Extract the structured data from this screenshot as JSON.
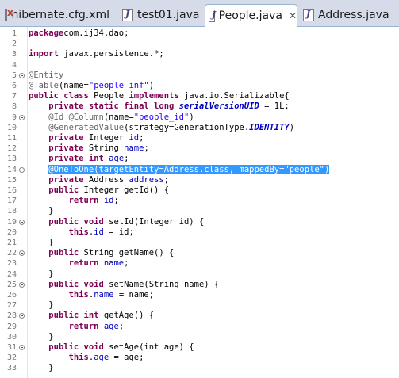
{
  "tabs": [
    {
      "label": "hibernate.cfg.xml",
      "icon": "xml-file-icon"
    },
    {
      "label": "test01.java",
      "icon": "java-file-icon"
    },
    {
      "label": "People.java",
      "icon": "java-file-icon",
      "active": true,
      "close": "✕"
    },
    {
      "label": "Address.java",
      "icon": "java-file-icon"
    }
  ],
  "editor": {
    "lines": [
      {
        "n": "1",
        "segs": [
          [
            "kw",
            "package"
          ],
          [
            "",
            "com.ij34.dao;"
          ]
        ]
      },
      {
        "n": "2",
        "segs": []
      },
      {
        "n": "3",
        "segs": [
          [
            "kw",
            "import"
          ],
          [
            "",
            " javax.persistence.*;"
          ]
        ]
      },
      {
        "n": "4",
        "segs": []
      },
      {
        "n": "5",
        "fold": true,
        "segs": [
          [
            "an",
            "@Entity"
          ]
        ]
      },
      {
        "n": "6",
        "segs": [
          [
            "an",
            "@Table"
          ],
          [
            "",
            "(name="
          ],
          [
            "st",
            "\"people_inf\""
          ],
          [
            "",
            ")"
          ]
        ]
      },
      {
        "n": "7",
        "segs": [
          [
            "kw",
            "public class"
          ],
          [
            "",
            " People "
          ],
          [
            "kw",
            "implements"
          ],
          [
            "",
            " java.io.Serializable{"
          ]
        ]
      },
      {
        "n": "8",
        "segs": [
          [
            "",
            "    "
          ],
          [
            "kw",
            "private static final long"
          ],
          [
            "",
            " "
          ],
          [
            "sf",
            "serialVersionUID"
          ],
          [
            "",
            " = 1L;"
          ]
        ]
      },
      {
        "n": "9",
        "fold": true,
        "segs": [
          [
            "",
            "    "
          ],
          [
            "an",
            "@Id @Column"
          ],
          [
            "",
            "(name="
          ],
          [
            "st",
            "\"people_id\""
          ],
          [
            "",
            ")"
          ]
        ]
      },
      {
        "n": "10",
        "segs": [
          [
            "",
            "    "
          ],
          [
            "an",
            "@GeneratedValue"
          ],
          [
            "",
            "(strategy=GenerationType."
          ],
          [
            "sf",
            "IDENTITY"
          ],
          [
            "",
            ")"
          ]
        ]
      },
      {
        "n": "11",
        "segs": [
          [
            "",
            "    "
          ],
          [
            "kw",
            "private"
          ],
          [
            "",
            " Integer "
          ],
          [
            "fd",
            "id"
          ],
          [
            "",
            ";"
          ]
        ]
      },
      {
        "n": "12",
        "segs": [
          [
            "",
            "    "
          ],
          [
            "kw",
            "private"
          ],
          [
            "",
            " String "
          ],
          [
            "fd",
            "name"
          ],
          [
            "",
            ";"
          ]
        ]
      },
      {
        "n": "13",
        "segs": [
          [
            "",
            "    "
          ],
          [
            "kw",
            "private int"
          ],
          [
            "",
            " "
          ],
          [
            "fd",
            "age"
          ],
          [
            "",
            ";"
          ]
        ]
      },
      {
        "n": "14",
        "fold": true,
        "highlight": true,
        "segs": [
          [
            "",
            "    "
          ],
          [
            "hl",
            "@OneToOne(targetEntity=Address.class, mappedBy=\"people\")"
          ]
        ]
      },
      {
        "n": "15",
        "segs": [
          [
            "",
            "    "
          ],
          [
            "kw",
            "private"
          ],
          [
            "",
            " Address "
          ],
          [
            "fd",
            "address"
          ],
          [
            "",
            ";"
          ]
        ]
      },
      {
        "n": "16",
        "segs": [
          [
            "",
            "    "
          ],
          [
            "kw",
            "public"
          ],
          [
            "",
            " Integer getId() {"
          ]
        ]
      },
      {
        "n": "17",
        "segs": [
          [
            "",
            "        "
          ],
          [
            "kw",
            "return"
          ],
          [
            "",
            " "
          ],
          [
            "fd",
            "id"
          ],
          [
            "",
            ";"
          ]
        ]
      },
      {
        "n": "18",
        "segs": [
          [
            "",
            "    }"
          ]
        ]
      },
      {
        "n": "19",
        "fold": true,
        "segs": [
          [
            "",
            "    "
          ],
          [
            "kw",
            "public void"
          ],
          [
            "",
            " setId(Integer id) {"
          ]
        ]
      },
      {
        "n": "20",
        "segs": [
          [
            "",
            "        "
          ],
          [
            "kw",
            "this"
          ],
          [
            "",
            "."
          ],
          [
            "fd",
            "id"
          ],
          [
            "",
            " = id;"
          ]
        ]
      },
      {
        "n": "21",
        "segs": [
          [
            "",
            "    }"
          ]
        ]
      },
      {
        "n": "22",
        "fold": true,
        "segs": [
          [
            "",
            "    "
          ],
          [
            "kw",
            "public"
          ],
          [
            "",
            " String getName() {"
          ]
        ]
      },
      {
        "n": "23",
        "segs": [
          [
            "",
            "        "
          ],
          [
            "kw",
            "return"
          ],
          [
            "",
            " "
          ],
          [
            "fd",
            "name"
          ],
          [
            "",
            ";"
          ]
        ]
      },
      {
        "n": "24",
        "segs": [
          [
            "",
            "    }"
          ]
        ]
      },
      {
        "n": "25",
        "fold": true,
        "segs": [
          [
            "",
            "    "
          ],
          [
            "kw",
            "public void"
          ],
          [
            "",
            " setName(String name) {"
          ]
        ]
      },
      {
        "n": "26",
        "segs": [
          [
            "",
            "        "
          ],
          [
            "kw",
            "this"
          ],
          [
            "",
            "."
          ],
          [
            "fd",
            "name"
          ],
          [
            "",
            " = name;"
          ]
        ]
      },
      {
        "n": "27",
        "segs": [
          [
            "",
            "    }"
          ]
        ]
      },
      {
        "n": "28",
        "fold": true,
        "segs": [
          [
            "",
            "    "
          ],
          [
            "kw",
            "public int"
          ],
          [
            "",
            " getAge() {"
          ]
        ]
      },
      {
        "n": "29",
        "segs": [
          [
            "",
            "        "
          ],
          [
            "kw",
            "return"
          ],
          [
            "",
            " "
          ],
          [
            "fd",
            "age"
          ],
          [
            "",
            ";"
          ]
        ]
      },
      {
        "n": "30",
        "segs": [
          [
            "",
            "    }"
          ]
        ]
      },
      {
        "n": "31",
        "fold": true,
        "segs": [
          [
            "",
            "    "
          ],
          [
            "kw",
            "public void"
          ],
          [
            "",
            " setAge(int age) {"
          ]
        ]
      },
      {
        "n": "32",
        "segs": [
          [
            "",
            "        "
          ],
          [
            "kw",
            "this"
          ],
          [
            "",
            "."
          ],
          [
            "fd",
            "age"
          ],
          [
            "",
            " = age;"
          ]
        ]
      },
      {
        "n": "33",
        "segs": [
          [
            "",
            "    }"
          ]
        ]
      }
    ]
  },
  "colors": {
    "keyword": "#7f0055",
    "annotation": "#646464",
    "string": "#2a00ff",
    "field": "#0000c0",
    "selection": "#3399ff"
  }
}
